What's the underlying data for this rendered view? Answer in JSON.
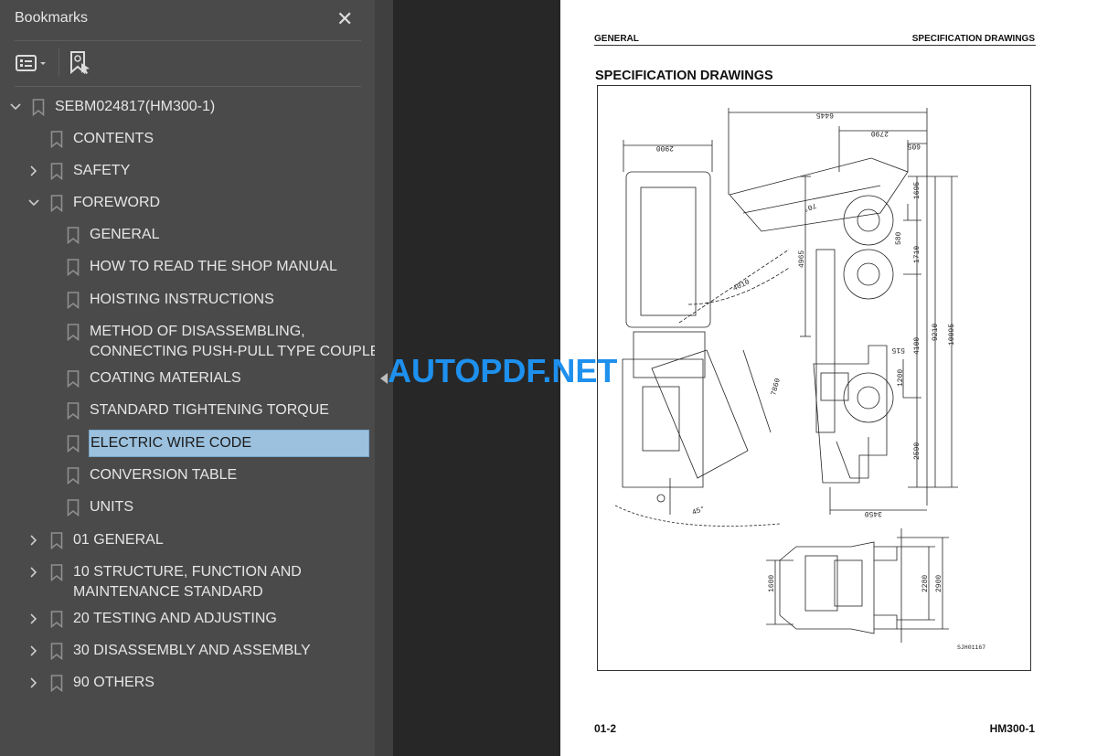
{
  "panel": {
    "title": "Bookmarks",
    "close_icon": "close-icon",
    "toolbar": {
      "options_icon": "list-options-icon",
      "find_icon": "find-bookmark-icon"
    }
  },
  "bookmarks": [
    {
      "label": "SEBM024817(HM300-1)",
      "level": 0,
      "toggle": "expanded"
    },
    {
      "label": "CONTENTS",
      "level": 1,
      "toggle": "none"
    },
    {
      "label": "SAFETY",
      "level": 1,
      "toggle": "collapsed"
    },
    {
      "label": "FOREWORD",
      "level": 1,
      "toggle": "expanded"
    },
    {
      "label": "GENERAL",
      "level": 2,
      "toggle": "none"
    },
    {
      "label": "HOW TO READ THE SHOP MANUAL",
      "level": 2,
      "toggle": "none"
    },
    {
      "label": "HOISTING INSTRUCTIONS",
      "level": 2,
      "toggle": "none"
    },
    {
      "label": "METHOD OF DISASSEMBLING,",
      "label2": "CONNECTING PUSH-PULL TYPE COUPLER",
      "level": 2,
      "toggle": "none"
    },
    {
      "label": "COATING MATERIALS",
      "level": 2,
      "toggle": "none"
    },
    {
      "label": "STANDARD TIGHTENING TORQUE",
      "level": 2,
      "toggle": "none"
    },
    {
      "label": "ELECTRIC WIRE CODE",
      "level": 2,
      "toggle": "none",
      "selected": true
    },
    {
      "label": "CONVERSION TABLE",
      "level": 2,
      "toggle": "none"
    },
    {
      "label": "UNITS",
      "level": 2,
      "toggle": "none"
    },
    {
      "label": "01 GENERAL",
      "level": 1,
      "toggle": "collapsed"
    },
    {
      "label": "10 STRUCTURE, FUNCTION AND",
      "label2": "MAINTENANCE STANDARD",
      "level": 1,
      "toggle": "collapsed"
    },
    {
      "label": "20 TESTING AND ADJUSTING",
      "level": 1,
      "toggle": "collapsed"
    },
    {
      "label": "30 DISASSEMBLY AND ASSEMBLY",
      "level": 1,
      "toggle": "collapsed"
    },
    {
      "label": "90  OTHERS",
      "level": 1,
      "toggle": "collapsed"
    }
  ],
  "watermark": "AUTOPDF.NET",
  "document": {
    "header_left": "GENERAL",
    "header_right": "SPECIFICATION DRAWINGS",
    "title": "SPECIFICATION DRAWINGS",
    "footer_left": "01-2",
    "footer_right": "HM300-1",
    "drawing": {
      "dims": {
        "d6445": "6445",
        "d2790": "2790",
        "d605": "605",
        "d2900top": "2900",
        "d1695": "1695",
        "d580": "580",
        "d1710": "1710",
        "d9210": "9210",
        "d10095": "10095",
        "d4100": "4100",
        "d515": "515",
        "d1200": "1200",
        "d2590": "2590",
        "d4965": "4965",
        "d4010": "4010",
        "d7860": "7860",
        "a70": "70°",
        "a45": "45°",
        "d3450": "3450",
        "d1600": "1600",
        "d2280": "2280",
        "d2900": "2900"
      },
      "code": "SJH01167"
    }
  },
  "colors": {
    "panel_bg": "#4a4a4a",
    "selection": "#9bc1de",
    "watermark": "#1e90ee"
  }
}
